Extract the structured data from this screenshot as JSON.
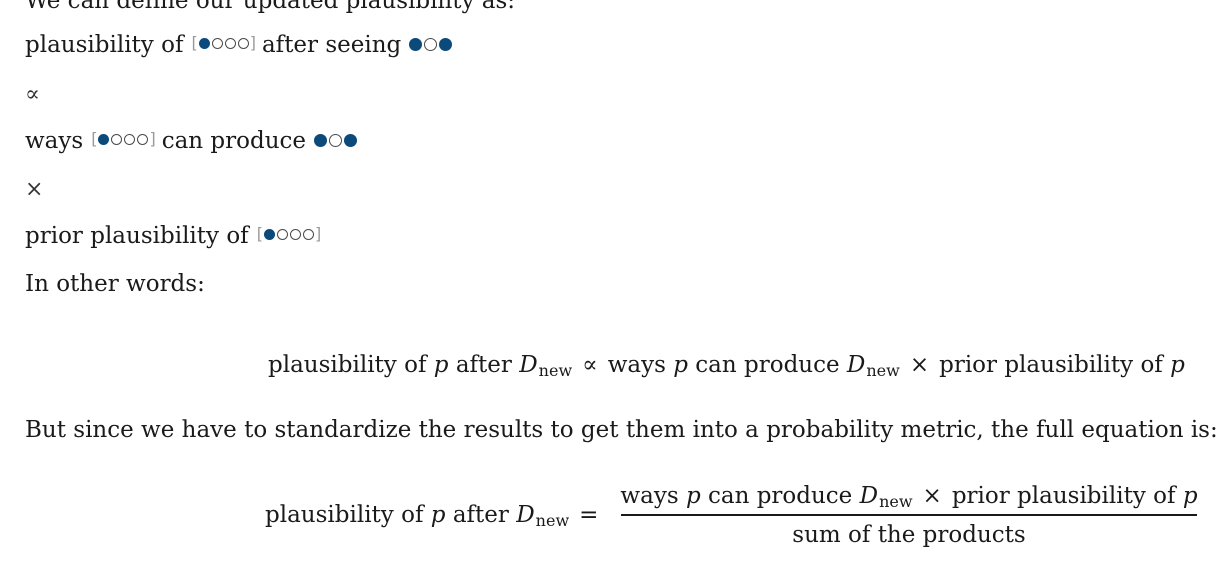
{
  "intro_text": "We can define our updated plausibility as:",
  "row1": {
    "before": "plausibility of",
    "after": "after seeing"
  },
  "row2_symbol": "∝",
  "row3": {
    "before": "ways",
    "after": "can produce"
  },
  "row4_symbol": "×",
  "row5": {
    "before": "prior plausibility of"
  },
  "in_other_words": "In other words:",
  "equation1": {
    "lhs": "plausibility of",
    "p": "p",
    "after": "after",
    "D": "D",
    "new": "new",
    "propto": "∝",
    "ways": "ways",
    "can_produce": "can produce",
    "times": "×",
    "prior": "prior plausibility of"
  },
  "standardize_text": "But since we have to standardize the results to get them into a probability metric, the full equation is:",
  "equation2": {
    "lhs": "plausibility of",
    "p": "p",
    "after": "after",
    "D": "D",
    "new": "new",
    "equals": "=",
    "ways": "ways",
    "can_produce": "can produce",
    "times": "×",
    "prior": "prior plausibility of",
    "denominator": "sum of the products"
  },
  "marbles": {
    "bag": [
      "blue",
      "white",
      "white",
      "white"
    ],
    "draw": [
      "blue",
      "white",
      "blue"
    ],
    "colors": {
      "blue": "#0b4a7a",
      "white": "#ffffff"
    }
  }
}
